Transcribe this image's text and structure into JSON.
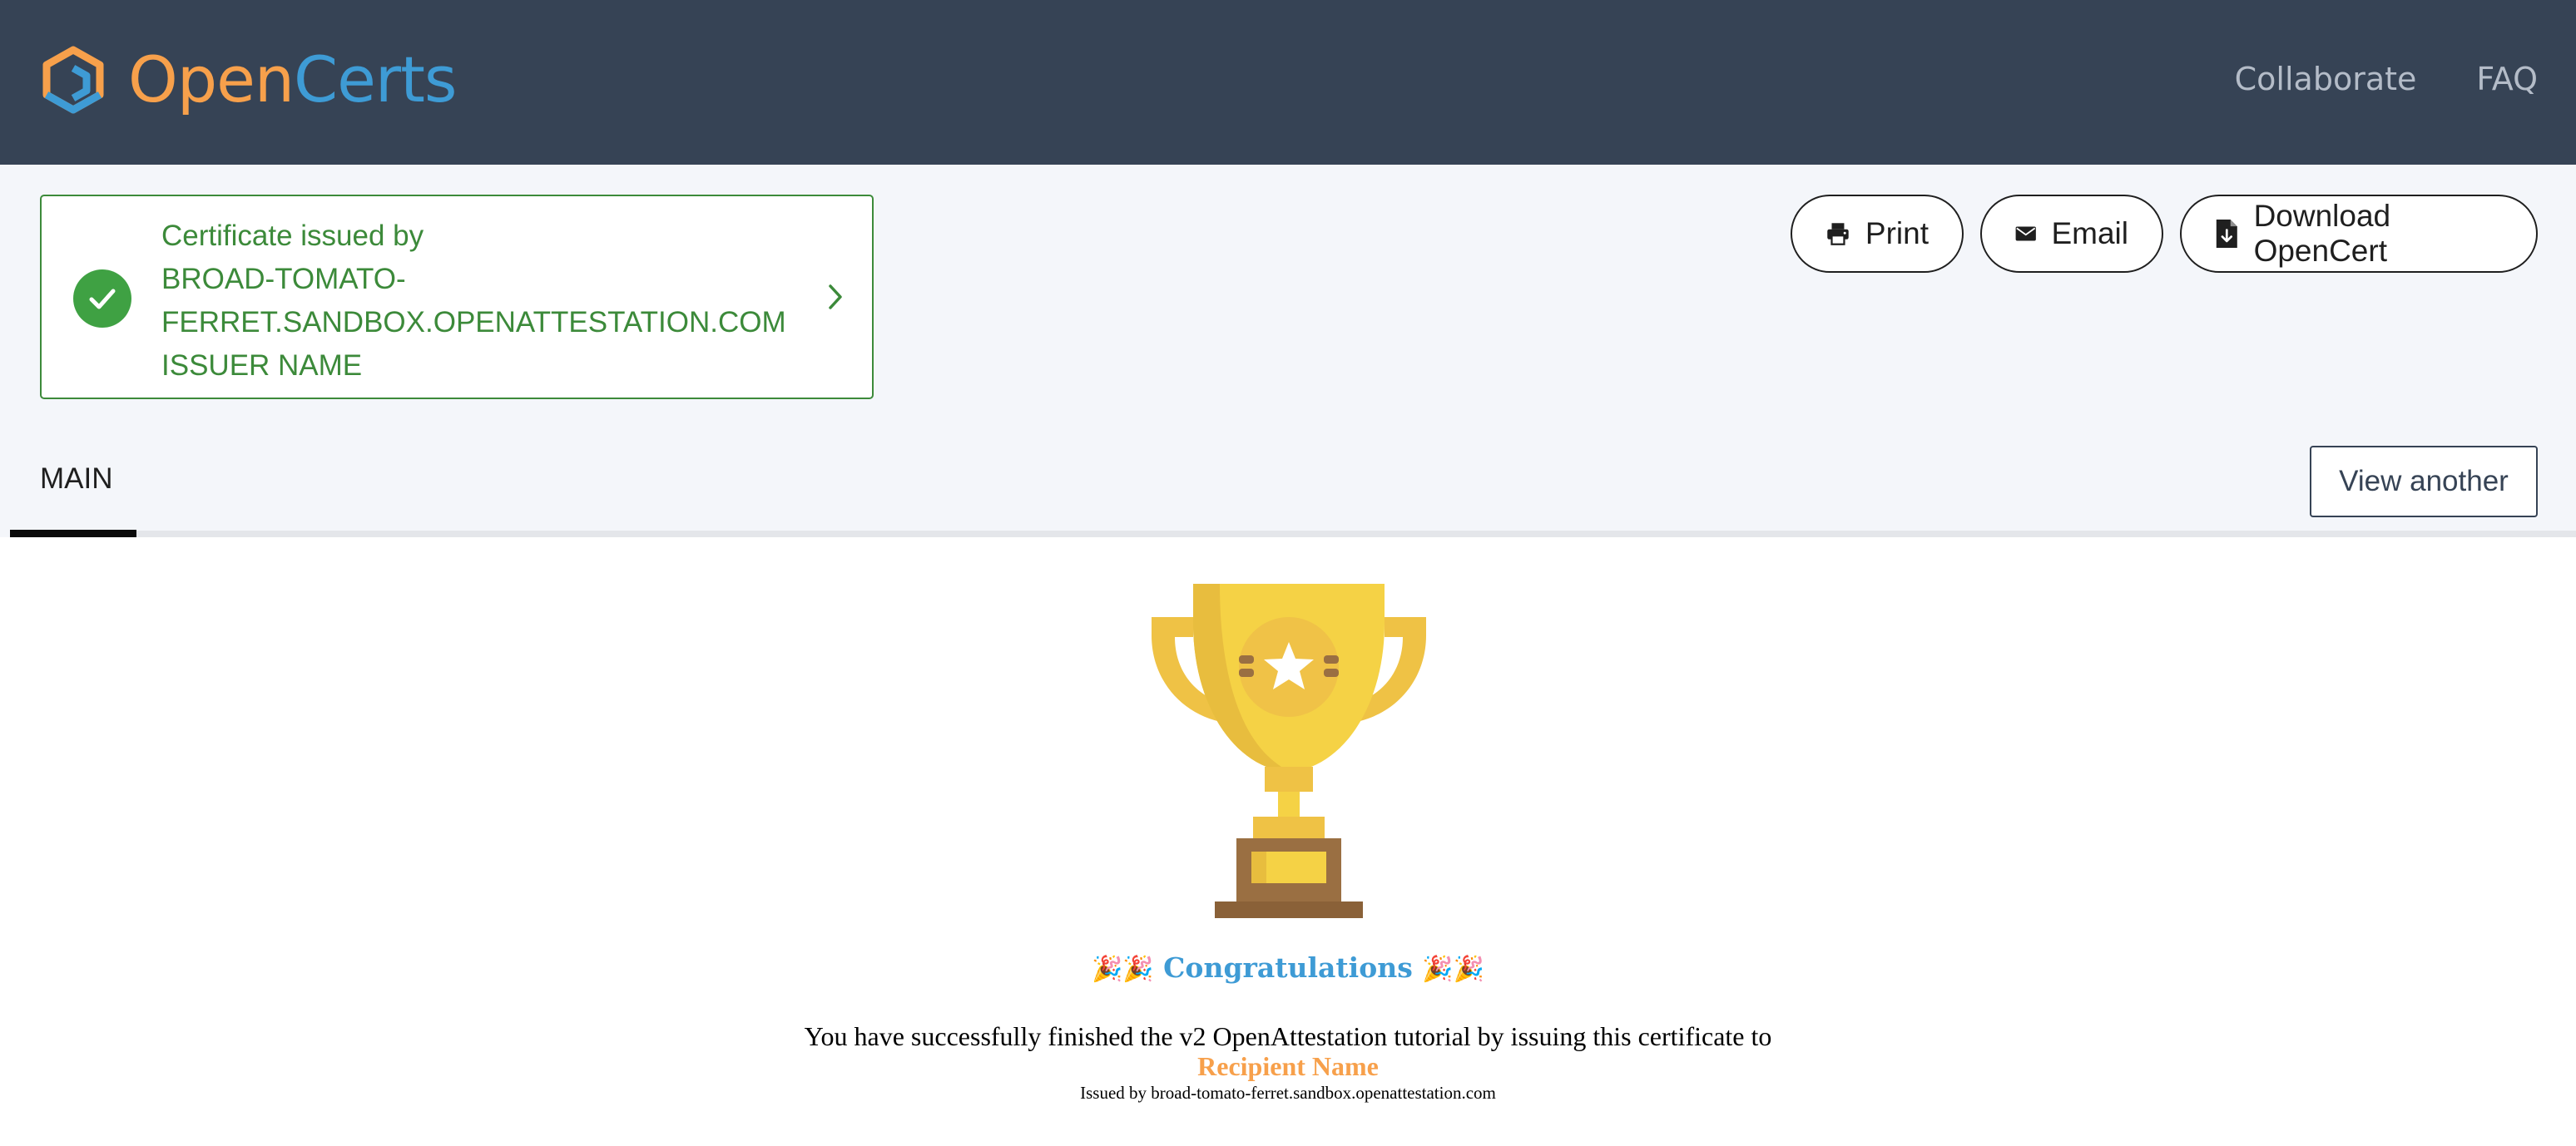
{
  "header": {
    "logo": {
      "open": "Open",
      "certs": "Certs"
    },
    "nav": [
      {
        "label": "Collaborate"
      },
      {
        "label": "FAQ"
      }
    ]
  },
  "status": {
    "line1": "Certificate issued by",
    "line2": "BROAD-TOMATO-",
    "line3": "FERRET.SANDBOX.OPENATTESTATION.COM",
    "line4": "ISSUER NAME"
  },
  "actions": {
    "print": "Print",
    "email": "Email",
    "download": "Download OpenCert"
  },
  "tabs": {
    "main": "MAIN",
    "view_another": "View another"
  },
  "certificate": {
    "emoji": "🎉🎉",
    "congrats": "Congratulations",
    "message": "You have successfully finished the v2 OpenAttestation tutorial by issuing this certificate to",
    "recipient": "Recipient Name",
    "issued_by": "Issued by broad-tomato-ferret.sandbox.openattestation.com"
  },
  "colors": {
    "header_bg": "#364355",
    "brand_orange": "#f7a04b",
    "brand_blue": "#3e9bd5",
    "success_green": "#3c8a3a",
    "status_bg": "#f4f6fa"
  },
  "icons": [
    "opencerts-logo-icon",
    "check-icon",
    "chevron-right-icon",
    "printer-icon",
    "envelope-icon",
    "file-download-icon",
    "trophy-icon"
  ]
}
